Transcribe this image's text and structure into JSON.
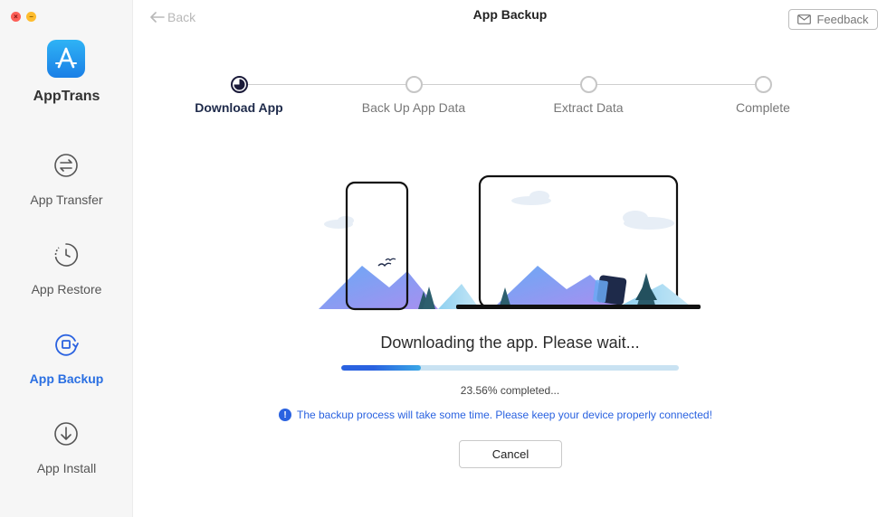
{
  "window": {
    "title": "App Backup",
    "close_glyph": "×",
    "minimize_glyph": "−"
  },
  "sidebar": {
    "app_name": "AppTrans",
    "items": [
      {
        "label": "App Transfer",
        "icon": "transfer-icon",
        "active": false
      },
      {
        "label": "App Restore",
        "icon": "restore-icon",
        "active": false
      },
      {
        "label": "App Backup",
        "icon": "backup-icon",
        "active": true
      },
      {
        "label": "App Install",
        "icon": "install-icon",
        "active": false
      }
    ]
  },
  "header": {
    "back_label": "Back",
    "feedback_label": "Feedback"
  },
  "steps": [
    {
      "label": "Download App",
      "active": true
    },
    {
      "label": "Back Up App Data",
      "active": false
    },
    {
      "label": "Extract Data",
      "active": false
    },
    {
      "label": "Complete",
      "active": false
    }
  ],
  "status": {
    "title": "Downloading the app. Please wait...",
    "progress_percent": 23.56,
    "percent_text": "23.56% completed...",
    "info_glyph": "!",
    "info_text": "The backup process will take some time. Please keep your device properly connected!",
    "cancel_label": "Cancel"
  },
  "colors": {
    "accent": "#2a62e0",
    "sidebar_bg": "#f6f6f6",
    "track": "#c9e2f2"
  }
}
